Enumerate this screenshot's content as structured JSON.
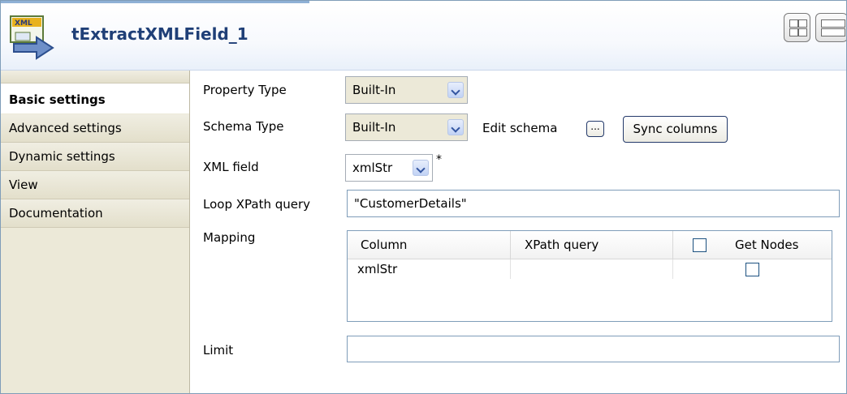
{
  "component": {
    "title": "tExtractXMLField_1",
    "icon": "xml-extract-icon"
  },
  "toolbar": {
    "view_buttons": [
      "grid-view-icon",
      "list-view-icon"
    ]
  },
  "sidebar": {
    "tabs": [
      {
        "label": "Basic settings",
        "active": true
      },
      {
        "label": "Advanced settings",
        "active": false
      },
      {
        "label": "Dynamic settings",
        "active": false
      },
      {
        "label": "View",
        "active": false
      },
      {
        "label": "Documentation",
        "active": false
      }
    ]
  },
  "form": {
    "property_type": {
      "label": "Property Type",
      "value": "Built-In"
    },
    "schema_type": {
      "label": "Schema Type",
      "value": "Built-In",
      "edit_label": "Edit schema",
      "ellipsis": "...",
      "sync_label": "Sync columns"
    },
    "xml_field": {
      "label": "XML field",
      "value": "xmlStr",
      "required_marker": "*"
    },
    "loop_xpath": {
      "label": "Loop XPath query",
      "value": "\"CustomerDetails\""
    },
    "mapping": {
      "label": "Mapping",
      "columns": [
        "Column",
        "XPath query",
        "Get Nodes"
      ],
      "rows": [
        {
          "column": "xmlStr",
          "xpath": "",
          "get_nodes": false
        }
      ]
    },
    "limit": {
      "label": "Limit",
      "value": ""
    }
  },
  "colors": {
    "title": "#1f3f77",
    "sidebar_bg": "#ece9d8",
    "border": "#7f9db9"
  }
}
